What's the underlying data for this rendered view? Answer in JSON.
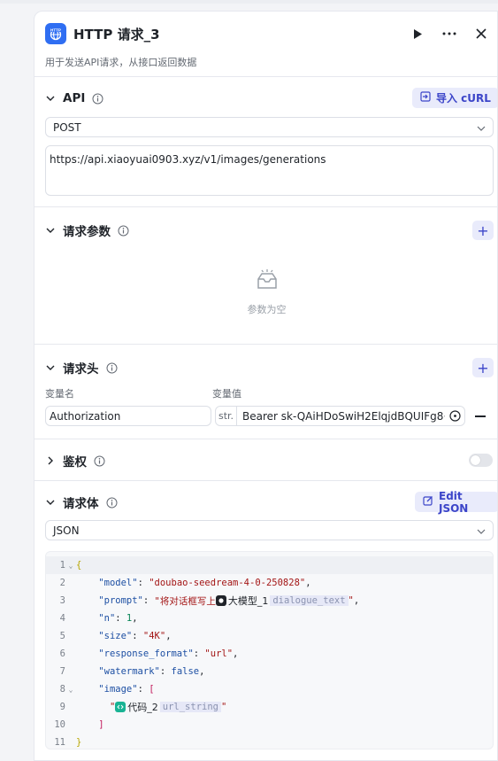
{
  "header": {
    "title": "HTTP 请求_3",
    "description": "用于发送API请求，从接口返回数据",
    "icon": "http-icon",
    "run_icon": "play-icon",
    "more_icon": "more-icon",
    "close_icon": "close-icon"
  },
  "api": {
    "title": "API",
    "import_label": "导入 cURL",
    "method": "POST",
    "url": "https://api.xiaoyuai0903.xyz/v1/images/generations"
  },
  "params": {
    "title": "请求参数",
    "empty_text": "参数为空"
  },
  "headers": {
    "title": "请求头",
    "col_name": "变量名",
    "col_value": "变量值",
    "row": {
      "name": "Authorization",
      "type": "str.",
      "value": "Bearer sk-QAiHDoSwiH2ElqjdBQUIFg8···"
    }
  },
  "auth": {
    "title": "鉴权",
    "enabled": false
  },
  "body": {
    "title": "请求体",
    "edit_label": "Edit JSON",
    "format": "JSON",
    "lines": {
      "l2_key": "\"model\"",
      "l2_val": "\"doubao-seedream-4-0-250828\"",
      "l3_key": "\"prompt\"",
      "l3_prefix": "\"将对话框写上",
      "l3_ref_node": "大模型_1",
      "l3_ref_var": "dialogue_text",
      "l4_key": "\"n\"",
      "l4_val": "1",
      "l5_key": "\"size\"",
      "l5_val": "\"4K\"",
      "l6_key": "\"response_format\"",
      "l6_val": "\"url\"",
      "l7_key": "\"watermark\"",
      "l7_val": "false",
      "l8_key": "\"image\"",
      "l9_ref_node": "代码_2",
      "l9_ref_var": "url_string"
    }
  },
  "colors": {
    "accent": "#3c45c9",
    "http_icon_bg": "#2f6ef2",
    "code_ref_icon": "#19b394"
  }
}
